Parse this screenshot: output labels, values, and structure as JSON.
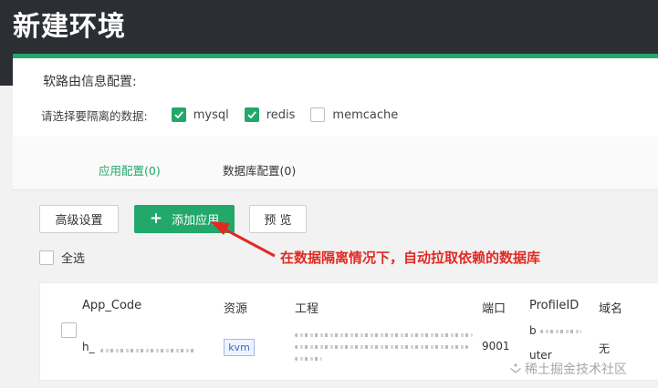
{
  "page": {
    "title": "新建环境"
  },
  "routing": {
    "title": "软路由信息配置:",
    "isolation_label": "请选择要隔离的数据:",
    "options": [
      {
        "label": "mysql",
        "checked": true
      },
      {
        "label": "redis",
        "checked": true
      },
      {
        "label": "memcache",
        "checked": false
      }
    ]
  },
  "tabs": [
    {
      "label": "应用配置(0)",
      "active": true
    },
    {
      "label": "数据库配置(0)",
      "active": false
    }
  ],
  "toolbar": {
    "advanced_label": "高级设置",
    "add_app_label": "添加应用",
    "preview_label": "预 览"
  },
  "select_all_label": "全选",
  "annotation": "在数据隔离情况下，自动拉取依赖的数据库",
  "table": {
    "columns": [
      "App_Code",
      "资源",
      "工程",
      "端口",
      "ProfileID",
      "域名"
    ],
    "rows": [
      {
        "app_code_prefix": "h_",
        "resource": "kvm",
        "port": "9001",
        "profile_prefix": "b",
        "profile_suffix": "uter",
        "domain": "无"
      }
    ]
  },
  "watermark": "稀土掘金技术社区",
  "colors": {
    "accent": "#23a86b",
    "header_bg": "#2b2f33",
    "annotation": "#e02a22"
  }
}
